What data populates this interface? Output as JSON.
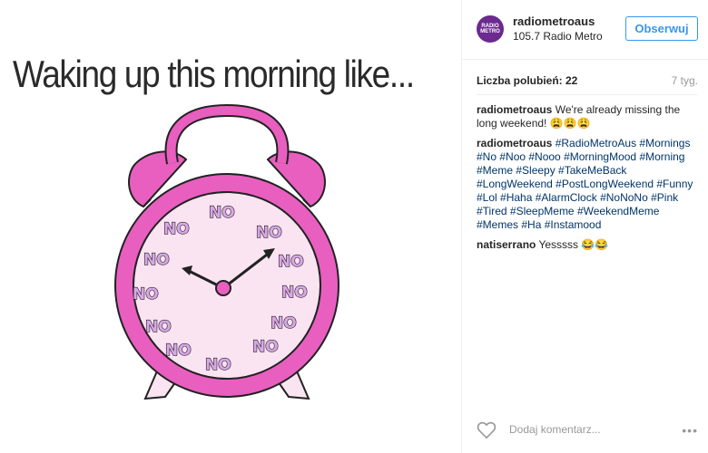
{
  "post_image": {
    "overlay_text": "Waking up this morning like...",
    "clock_word": "NO"
  },
  "header": {
    "avatar_text_top": "RADIO",
    "avatar_text_bottom": "METRO",
    "username": "radiometroaus",
    "location": "105.7 Radio Metro",
    "follow_label": "Obserwuj"
  },
  "stats": {
    "likes": "Liczba polubień: 22",
    "time": "7 tyg."
  },
  "comments": [
    {
      "user": "radiometroaus",
      "text": "We're already missing the long weekend! 😩😩😩"
    },
    {
      "user": "radiometroaus",
      "text": "#RadioMetroAus #Mornings #No #Noo #Nooo #MorningMood #Morning #Meme #Sleepy #TakeMeBack #LongWeekend #PostLongWeekend #Funny #Lol #Haha #AlarmClock #NoNoNo #Pink #Tired #SleepMeme #WeekendMeme #Memes #Ha #Instamood"
    },
    {
      "user": "natiserrano",
      "text": "Yesssss 😂😂"
    }
  ],
  "add_comment": {
    "placeholder": "Dodaj komentarz...",
    "more_label": "•••"
  },
  "colors": {
    "clock_pink": "#e85fc0",
    "clock_face": "#fbe4f2",
    "no_fill": "#d9a7e6",
    "link_blue": "#003569",
    "follow_blue": "#3897f0"
  }
}
